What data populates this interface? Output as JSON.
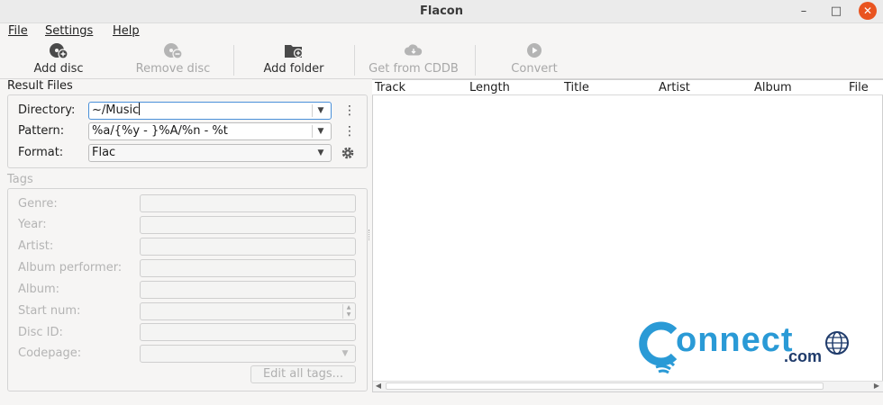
{
  "window": {
    "title": "Flacon",
    "minimize": "–",
    "maximize": "□",
    "close": "✕"
  },
  "menu": {
    "file": "File",
    "settings": "Settings",
    "help": "Help"
  },
  "toolbar": {
    "add_disc": "Add disc",
    "remove_disc": "Remove disc",
    "add_folder": "Add folder",
    "get_from_cddb": "Get from CDDB",
    "convert": "Convert"
  },
  "result_files": {
    "title": "Result Files",
    "directory_label": "Directory:",
    "directory_value": "~/Music",
    "pattern_label": "Pattern:",
    "pattern_value": "%a/{%y - }%A/%n - %t",
    "format_label": "Format:",
    "format_value": "Flac"
  },
  "tags": {
    "title": "Tags",
    "genre": "Genre:",
    "year": "Year:",
    "artist": "Artist:",
    "album_performer": "Album performer:",
    "album": "Album:",
    "start_num": "Start num:",
    "disc_id": "Disc ID:",
    "codepage": "Codepage:",
    "edit_all": "Edit all tags..."
  },
  "track_list": {
    "columns": [
      "Track",
      "Length",
      "Title",
      "Artist",
      "Album",
      "File"
    ]
  },
  "watermark": {
    "main": "onnect",
    "letter": "C",
    "sub": ".com"
  },
  "colors": {
    "accent_close": "#e95420",
    "logo_blue": "#2a9ad6",
    "logo_dark": "#1f3b6b"
  }
}
